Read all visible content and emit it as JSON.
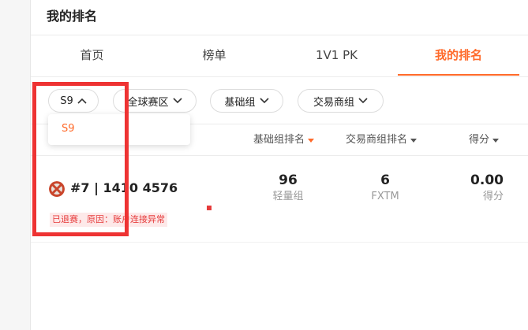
{
  "header": {
    "title": "我的排名"
  },
  "tabs": [
    {
      "label": "首页"
    },
    {
      "label": "榜单"
    },
    {
      "label": "1V1 PK"
    },
    {
      "label": "我的排名"
    }
  ],
  "active_tab": "我的排名",
  "filters": {
    "season": "S9",
    "region": "全球赛区",
    "group": "基础组",
    "broker_group": "交易商组"
  },
  "season_dropdown": {
    "options": [
      "S9"
    ]
  },
  "columns": {
    "basic_rank": "基础组排名",
    "broker_rank": "交易商组排名",
    "score": "得分"
  },
  "ranking_row": {
    "rank_and_id": "#7 | 1410  4576",
    "status": "已退赛，原因：账户连接异常",
    "basic_rank_value": "96",
    "basic_rank_label": "轻量组",
    "broker_rank_value": "6",
    "broker_rank_label": "FXTM",
    "score_value": "0.00",
    "score_label": "得分"
  },
  "colors": {
    "accent": "#ff6a2a",
    "highlight_box": "#ee3333",
    "status_red": "#e63b3b"
  },
  "icons": {
    "avatar": "xbox-style-avatar-icon",
    "filter_open": "chevron-up-icon",
    "filter_closed": "chevron-down-icon",
    "sort": "sort-down-triangle-icon"
  }
}
